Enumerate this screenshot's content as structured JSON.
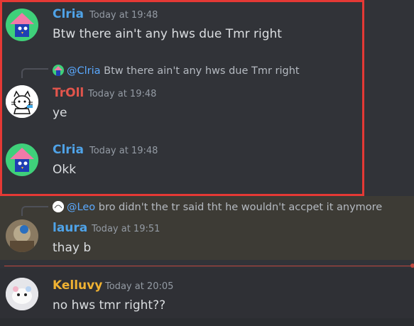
{
  "messages": [
    {
      "author": "Clria",
      "author_color": "#4fa3e8",
      "time": "Today at 19:48",
      "text": "Btw there ain't any hws  due Tmr right"
    },
    {
      "author": "TrOll",
      "author_color": "#e2554c",
      "time": "Today at 19:48",
      "text": "ye",
      "reply": {
        "mention": "@Clria",
        "text": "Btw there ain't any hws due Tmr right"
      }
    },
    {
      "author": "Clria",
      "author_color": "#4fa3e8",
      "time": "Today at 19:48",
      "text": "Okk"
    },
    {
      "author": "laura",
      "author_color": "#4fa3e8",
      "time": "Today at 19:51",
      "text": "thay b",
      "reply": {
        "mention": "@Leo",
        "text": "bro didn't the tr said tht he wouldn't accpet it anymore"
      }
    },
    {
      "author": "Kelluvy",
      "author_color": "#f0b232",
      "time": "Today at 20:05",
      "text": "no hws tmr right??"
    }
  ]
}
